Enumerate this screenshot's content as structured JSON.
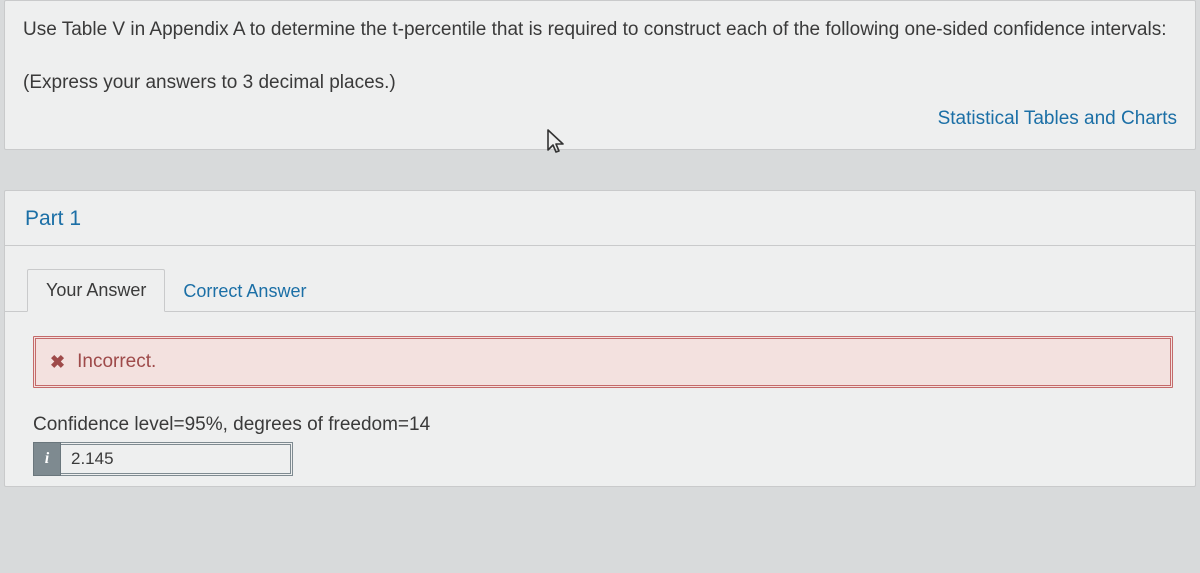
{
  "question": {
    "text": "Use Table V in Appendix A to determine the t-percentile that is required to construct each of the following one-sided confidence intervals:",
    "subnote": "(Express your answers to 3 decimal places.)",
    "stat_link": "Statistical Tables and Charts"
  },
  "part": {
    "title": "Part 1",
    "tabs": {
      "your_answer": "Your Answer",
      "correct_answer": "Correct Answer"
    },
    "banner": {
      "label": "Incorrect."
    },
    "prompt": "Confidence level=95%, degrees of freedom=14",
    "info_badge": "i",
    "answer_value": "2.145"
  }
}
